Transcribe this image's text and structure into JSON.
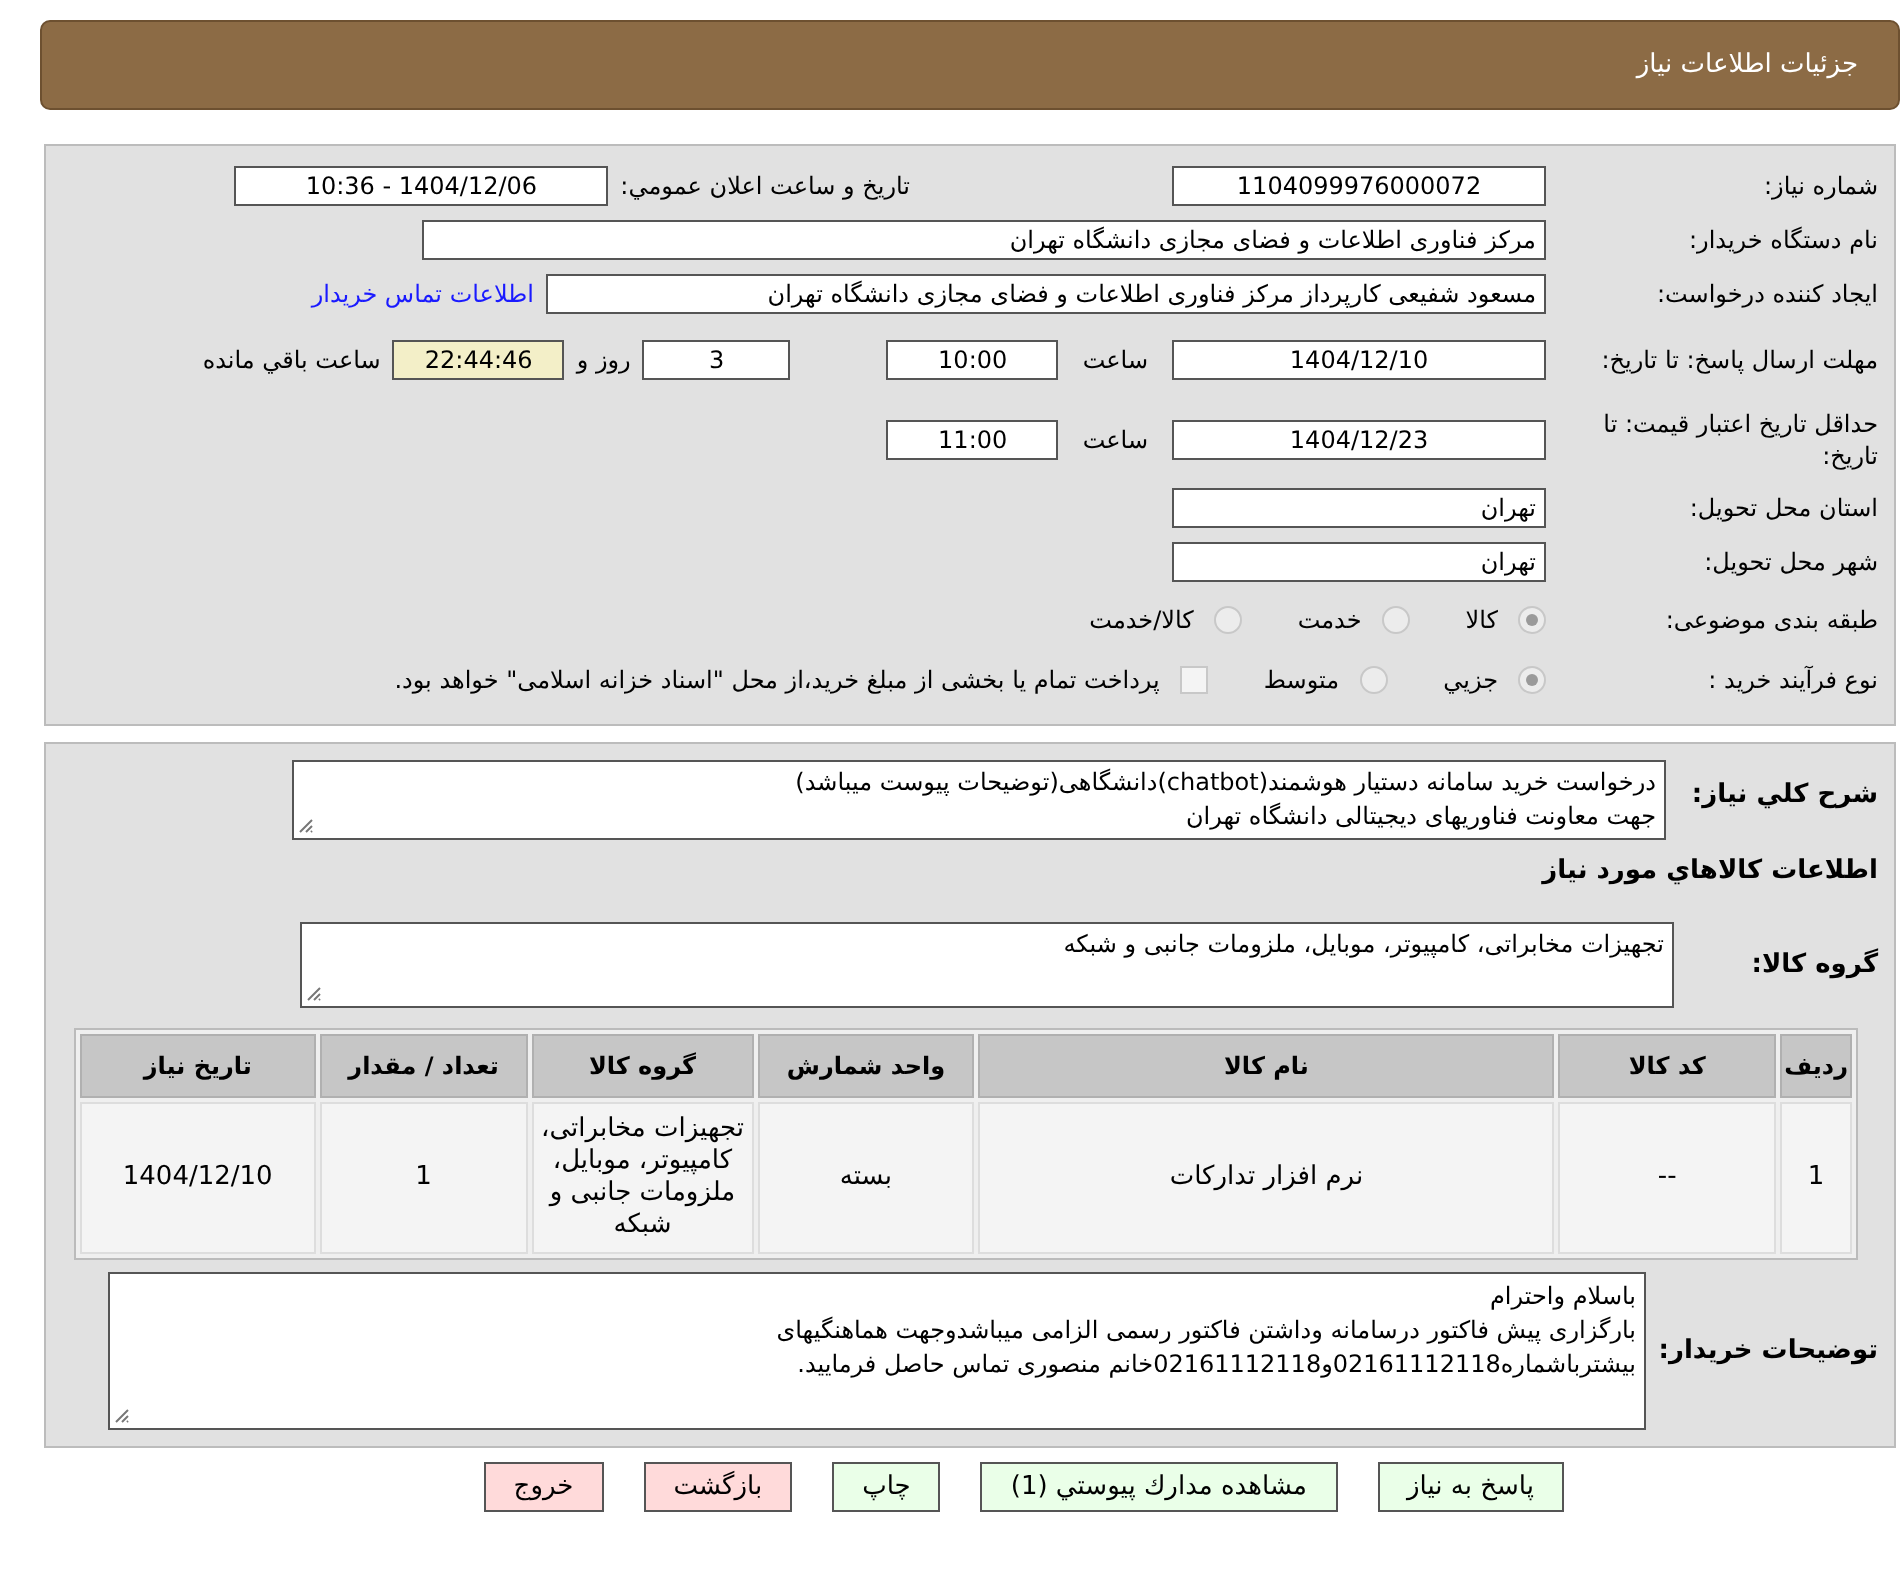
{
  "header": {
    "title": "جزئیات اطلاعات نیاز"
  },
  "need_number": {
    "label": "شماره نیاز:",
    "value": "1104099976000072"
  },
  "announce": {
    "label": "تاریخ و ساعت اعلان عمومي:",
    "value": "1404/12/06 - 10:36"
  },
  "buyer_org": {
    "label": "نام دستگاه خريدار:",
    "value": "مرکز فناوری اطلاعات و فضای مجازی دانشگاه تهران"
  },
  "requester": {
    "label": "ايجاد کننده درخواست:",
    "value": "مسعود شفیعی کارپرداز مرکز فناوری اطلاعات و فضای مجازی دانشگاه تهران",
    "contact_link": "اطلاعات تماس خريدار"
  },
  "reply_deadline": {
    "label": "مهلت ارسال پاسخ: تا تاریخ:",
    "date": "1404/12/10",
    "time_label": "ساعت",
    "time": "10:00",
    "days": "3",
    "days_label": "روز و",
    "remaining": "22:44:46",
    "remaining_label": "ساعت باقي مانده"
  },
  "price_validity": {
    "label": "حداقل تاریخ اعتبار قیمت: تا تاریخ:",
    "date": "1404/12/23",
    "time_label": "ساعت",
    "time": "11:00"
  },
  "province": {
    "label": "استان محل تحويل:",
    "value": "تهران"
  },
  "city": {
    "label": "شهر محل تحويل:",
    "value": "تهران"
  },
  "category": {
    "label": "طبقه بندی موضوعی:",
    "options": [
      {
        "label": "کالا",
        "selected": true
      },
      {
        "label": "خدمت",
        "selected": false
      },
      {
        "label": "کالا/خدمت",
        "selected": false
      }
    ]
  },
  "process": {
    "label": "نوع فرآیند خرید :",
    "options": [
      {
        "label": "جزيي",
        "selected": true
      },
      {
        "label": "متوسط",
        "selected": false
      }
    ],
    "treasury": {
      "label": "پرداخت تمام یا بخشی از مبلغ خرید،از محل \"اسناد خزانه اسلامی\" خواهد بود.",
      "checked": false
    }
  },
  "description": {
    "label": "شرح کلي نياز:",
    "lines": [
      "درخواست خرید سامانه دستیار هوشمند(chatbot)دانشگاهی(توضیحات پیوست میباشد)",
      "جهت معاونت فناوریهای دیجیتالی دانشگاه تهران"
    ]
  },
  "goods_heading": "اطلاعات کالاهاي مورد نياز",
  "goods_group": {
    "label": "گروه کالا:",
    "value": "تجهیزات مخابراتی، کامپیوتر، موبایل، ملزومات جانبی و شبکه"
  },
  "table": {
    "columns": [
      "رديف",
      "کد کالا",
      "نام کالا",
      "واحد شمارش",
      "گروه کالا",
      "تعداد / مقدار",
      "تاریخ نیاز"
    ],
    "rows": [
      [
        "1",
        "--",
        "نرم افزار تدارکات",
        "بسته",
        "تجهیزات مخابراتی، کامپیوتر، موبایل، ملزومات جانبی و شبکه",
        "1",
        "1404/12/10"
      ]
    ]
  },
  "buyer_notes": {
    "label": "توضیحات خريدار:",
    "lines": [
      "باسلام واحترام",
      "بارگزاری پیش فاکتور درسامانه وداشتن فاکتور رسمی الزامی میباشدوجهت هماهنگیهای",
      "بیشترباشماره02161112118و02161112118خانم منصوری تماس حاصل فرمایید."
    ]
  },
  "buttons": [
    {
      "label": "پاسخ به نیاز",
      "kind": "action"
    },
    {
      "label": "مشاهده مدارك پيوستي (1)",
      "kind": "action"
    },
    {
      "label": "چاپ",
      "kind": "action"
    },
    {
      "label": "بازگشت",
      "kind": "danger"
    },
    {
      "label": "خروج",
      "kind": "danger"
    }
  ]
}
